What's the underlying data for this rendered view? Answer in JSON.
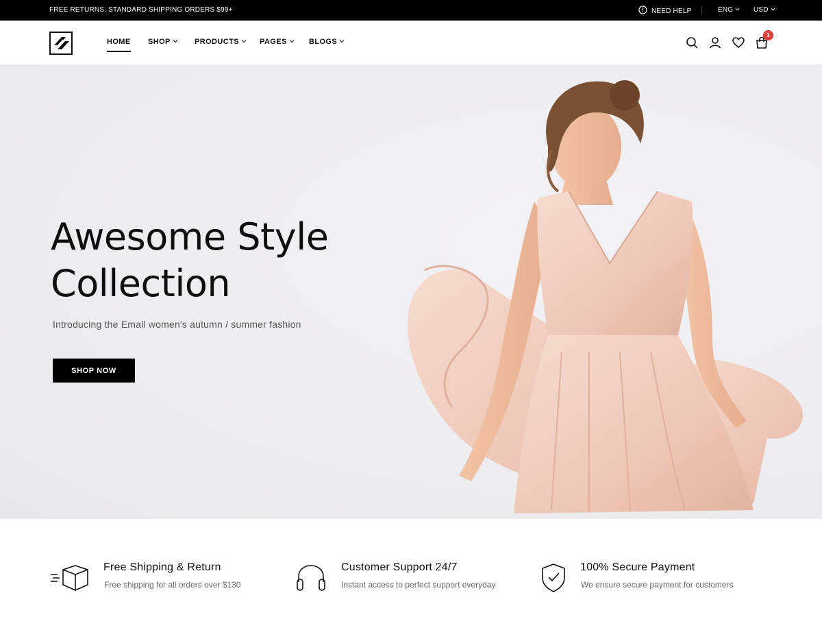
{
  "topbar": {
    "promo": "FREE RETURNS. STANDARD SHIPPING ORDERS $99+",
    "help": "NEED HELP",
    "language": "ENG",
    "currency": "USD"
  },
  "header": {
    "nav": [
      {
        "label": "HOME"
      },
      {
        "label": "SHOP"
      },
      {
        "label": "PRODUCTS"
      },
      {
        "label": "PAGES"
      },
      {
        "label": "BLOGS"
      }
    ],
    "cart_count": "3",
    "icons": [
      "search-icon",
      "user-icon",
      "heart-icon",
      "cart-icon"
    ]
  },
  "hero": {
    "title_line1": "Awesome Style",
    "title_line2": "Collection",
    "subtitle": "Introducing the Emall women's autumn / summer fashion",
    "cta": "SHOP NOW"
  },
  "features": [
    {
      "icon": "box-shipping-icon",
      "title": "Free Shipping & Return",
      "desc": "Free shipping for all orders over $130"
    },
    {
      "icon": "headphones-icon",
      "title": "Customer Support 24/7",
      "desc": "Instant access to perfect support everyday"
    },
    {
      "icon": "shield-check-icon",
      "title": "100% Secure Payment",
      "desc": "We ensure secure payment for customers"
    }
  ],
  "colors": {
    "topbar_bg": "#000000",
    "hero_bg": "#eeedf0",
    "button_bg": "#000000",
    "badge": "#e0403a",
    "dress": "#f1cfc0"
  }
}
